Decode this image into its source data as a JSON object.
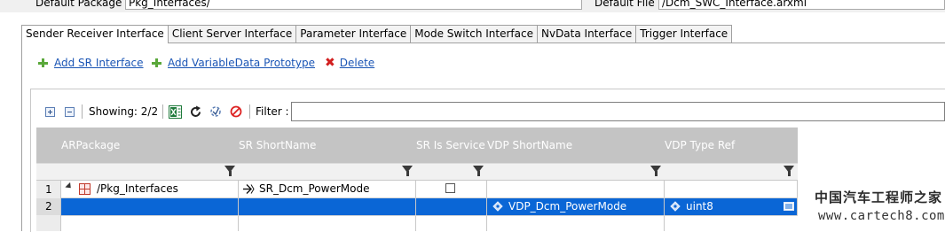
{
  "top": {
    "default_package_label": "Default Package",
    "default_package_value": "Pkg_Interfaces/",
    "default_file_label": "Default File",
    "default_file_value": "/Dcm_SWC_Interface.arxml"
  },
  "tabs": [
    {
      "label": "Sender Receiver Interface",
      "active": true
    },
    {
      "label": "Client Server Interface"
    },
    {
      "label": "Parameter Interface"
    },
    {
      "label": "Mode Switch Interface"
    },
    {
      "label": "NvData Interface"
    },
    {
      "label": "Trigger Interface"
    }
  ],
  "actions": {
    "add_sr": "Add SR Interface",
    "add_vdp": "Add VariableData Prototype ",
    "delete": "Delete "
  },
  "toolbar": {
    "showing": "Showing: 2/2",
    "filter_label": "Filter :",
    "filter_value": ""
  },
  "grid": {
    "columns": [
      "ARPackage",
      "SR ShortName",
      "SR Is Service",
      "VDP ShortName",
      "VDP Type Ref"
    ],
    "rows": [
      {
        "num": "1",
        "arpackage": "/Pkg_Interfaces",
        "sr_shortname": "SR_Dcm_PowerMode",
        "sr_is_service": false,
        "vdp_shortname": "",
        "vdp_type_ref": ""
      },
      {
        "num": "2",
        "arpackage": "",
        "sr_shortname": "",
        "vdp_shortname": "VDP_Dcm_PowerMode",
        "vdp_type_ref": "uint8",
        "selected": true
      }
    ]
  },
  "watermark": {
    "line1": "中国汽车工程师之家",
    "line2": "www.cartech8.com"
  }
}
